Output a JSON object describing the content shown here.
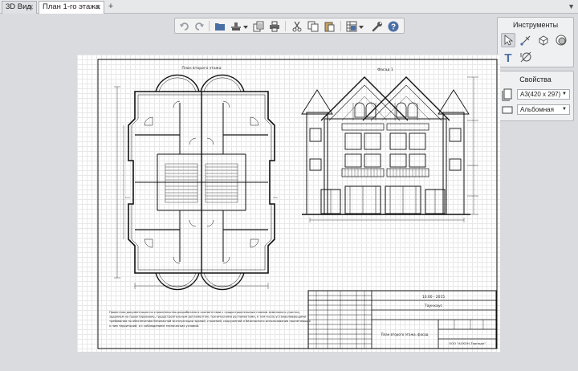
{
  "tabs": [
    {
      "label": "3D Вид",
      "active": false
    },
    {
      "label": "План 1-го этажа",
      "active": true
    }
  ],
  "toolbar": {
    "icons": [
      "undo-icon",
      "redo-icon",
      "folder-icon",
      "print-setup-icon",
      "dropdown-icon",
      "page-copy-icon",
      "print-icon",
      "cut-icon",
      "copy-icon",
      "paste-icon",
      "layers-icon",
      "dropdown-icon",
      "settings-wrench-icon",
      "help-icon"
    ],
    "help_glyph": "?"
  },
  "tools_panel": {
    "title": "Инструменты",
    "tools": [
      "select-arrow-icon",
      "measure-icon",
      "shape-3d-icon",
      "hatch-icon",
      "text-icon",
      "dimension-icon"
    ],
    "text_glyph": "T"
  },
  "properties_panel": {
    "title": "Свойства",
    "paper_size": "А3(420 x 297)",
    "orientation": "Альбомная"
  },
  "sheet": {
    "plan_title": "План второго этажа",
    "facade_title": "Фасад 1",
    "note": "Проектная документация на строительство разработана в соответствии с градостроительным планом земельного участка, заданием на проектирование, градостроительным регламентом, техническими регламентами, в том числе устанавливающими требования по обеспечению безопасной эксплуатации зданий, строений, сооружений и безопасного использования прилегающих к ним территорий, и с соблюдением технических условий.",
    "title_block": {
      "code": "10.00 - 2015",
      "name": "Таунхаус",
      "sheet_desc": "План второго этажа, фасад",
      "company": "ООО \"АСКОН-Торнадо\""
    }
  }
}
